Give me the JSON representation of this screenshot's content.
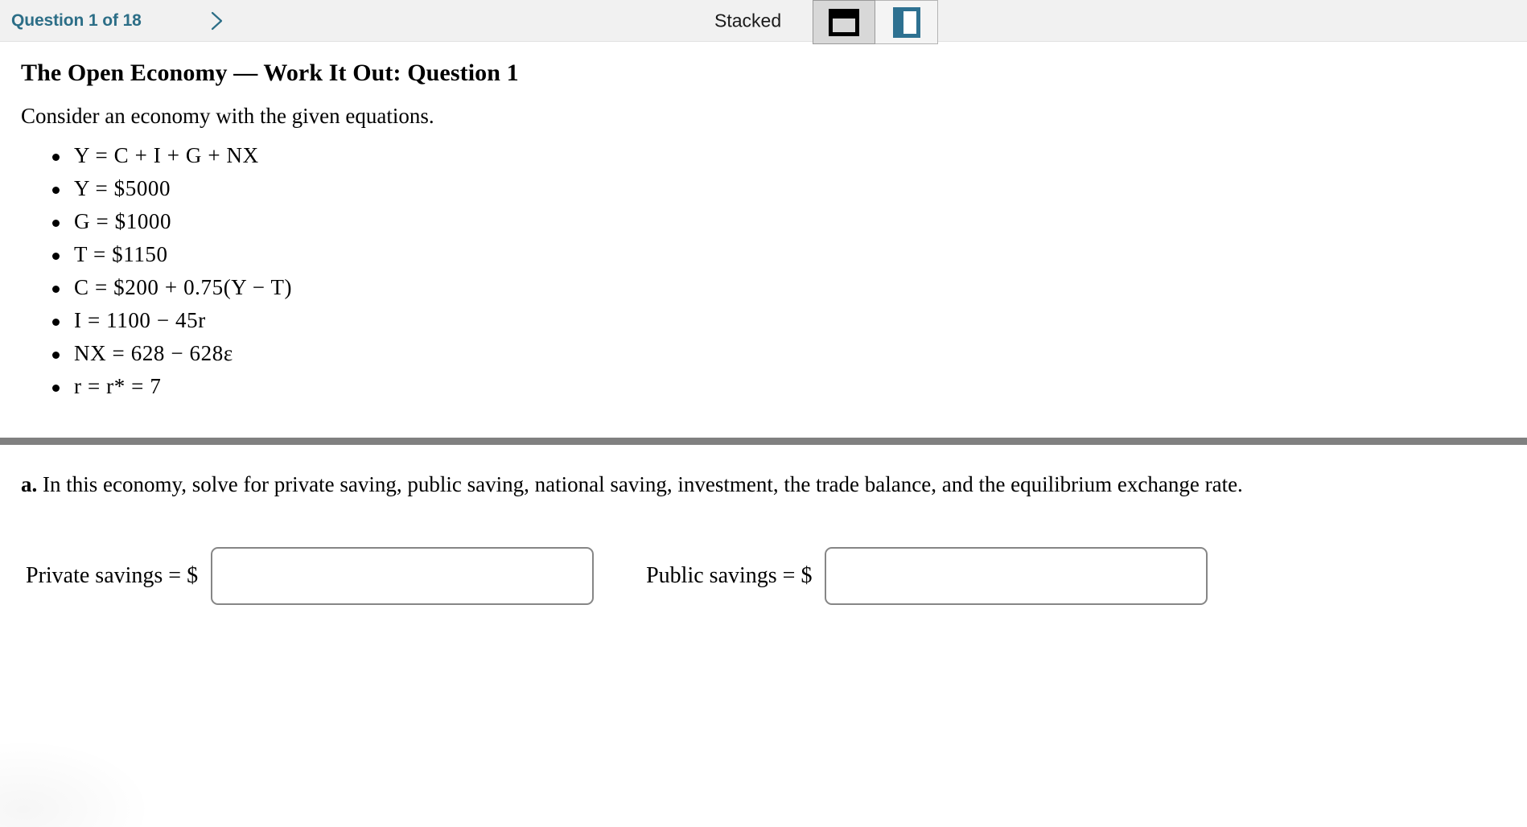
{
  "header": {
    "question_counter": "Question 1 of 18",
    "next_icon": "chevron-right-icon",
    "stacked_label": "Stacked",
    "layout_buttons": [
      {
        "name": "stacked-layout",
        "icon": "stacked-layout-icon",
        "selected": true,
        "color": "#000000"
      },
      {
        "name": "side-by-side-layout",
        "icon": "side-by-side-layout-icon",
        "selected": false,
        "color": "#2e7191"
      }
    ],
    "accent_color": "#2c6e87",
    "background_color": "#f1f1f1"
  },
  "content": {
    "title": "The Open Economy — Work It Out: Question 1",
    "intro": "Consider an economy with the given equations.",
    "equations": [
      "Y = C + I + G + NX",
      "Y = $5000",
      "G = $1000",
      "T = $1150",
      "C = $200 + 0.75(Y − T)",
      "I = 1100 − 45r",
      "NX = 628 − 628ε",
      "r = r* = 7"
    ]
  },
  "part": {
    "label": "a.",
    "text": "In this economy, solve for private saving, public saving, national saving, investment, the trade balance, and the equilibrium exchange rate."
  },
  "answers": [
    {
      "label": "Private savings = $",
      "value": "",
      "placeholder": ""
    },
    {
      "label": "Public savings = $",
      "value": "",
      "placeholder": ""
    }
  ]
}
